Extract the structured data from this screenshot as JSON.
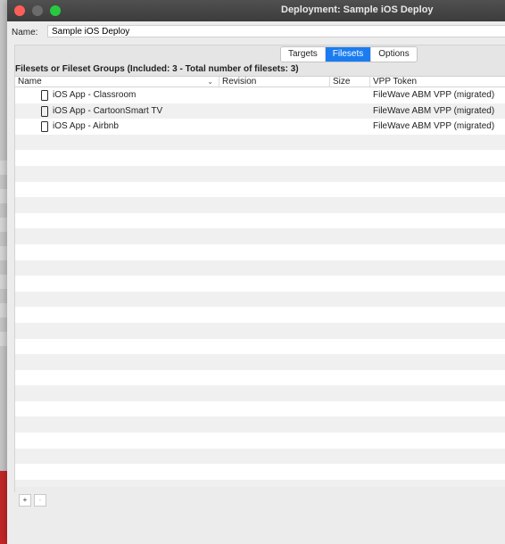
{
  "window": {
    "title": "Deployment: Sample iOS Deploy"
  },
  "name_field": {
    "label": "Name:",
    "value": "Sample iOS Deploy"
  },
  "tabs": [
    {
      "label": "Targets",
      "active": false
    },
    {
      "label": "Filesets",
      "active": true
    },
    {
      "label": "Options",
      "active": false
    }
  ],
  "group_heading": "Filesets or Fileset Groups (Included: 3 - Total number of filesets: 3)",
  "table": {
    "columns": [
      "Name",
      "Revision",
      "Size",
      "VPP Token"
    ],
    "rows": [
      {
        "icon": "iphone-icon",
        "name": "iOS App - Classroom",
        "revision": "",
        "size": "",
        "vpp": "FileWave ABM VPP (migrated)"
      },
      {
        "icon": "iphone-icon",
        "name": "iOS App - CartoonSmart TV",
        "revision": "",
        "size": "",
        "vpp": "FileWave ABM VPP (migrated)"
      },
      {
        "icon": "iphone-icon",
        "name": "iOS App - Airbnb",
        "revision": "",
        "size": "",
        "vpp": "FileWave ABM VPP (migrated)"
      }
    ]
  },
  "buttons": {
    "add": "+",
    "remove": "-"
  },
  "colors": {
    "tab_active_bg": "#1a7cf0",
    "close": "#ff5f57",
    "maximize": "#28c840"
  }
}
